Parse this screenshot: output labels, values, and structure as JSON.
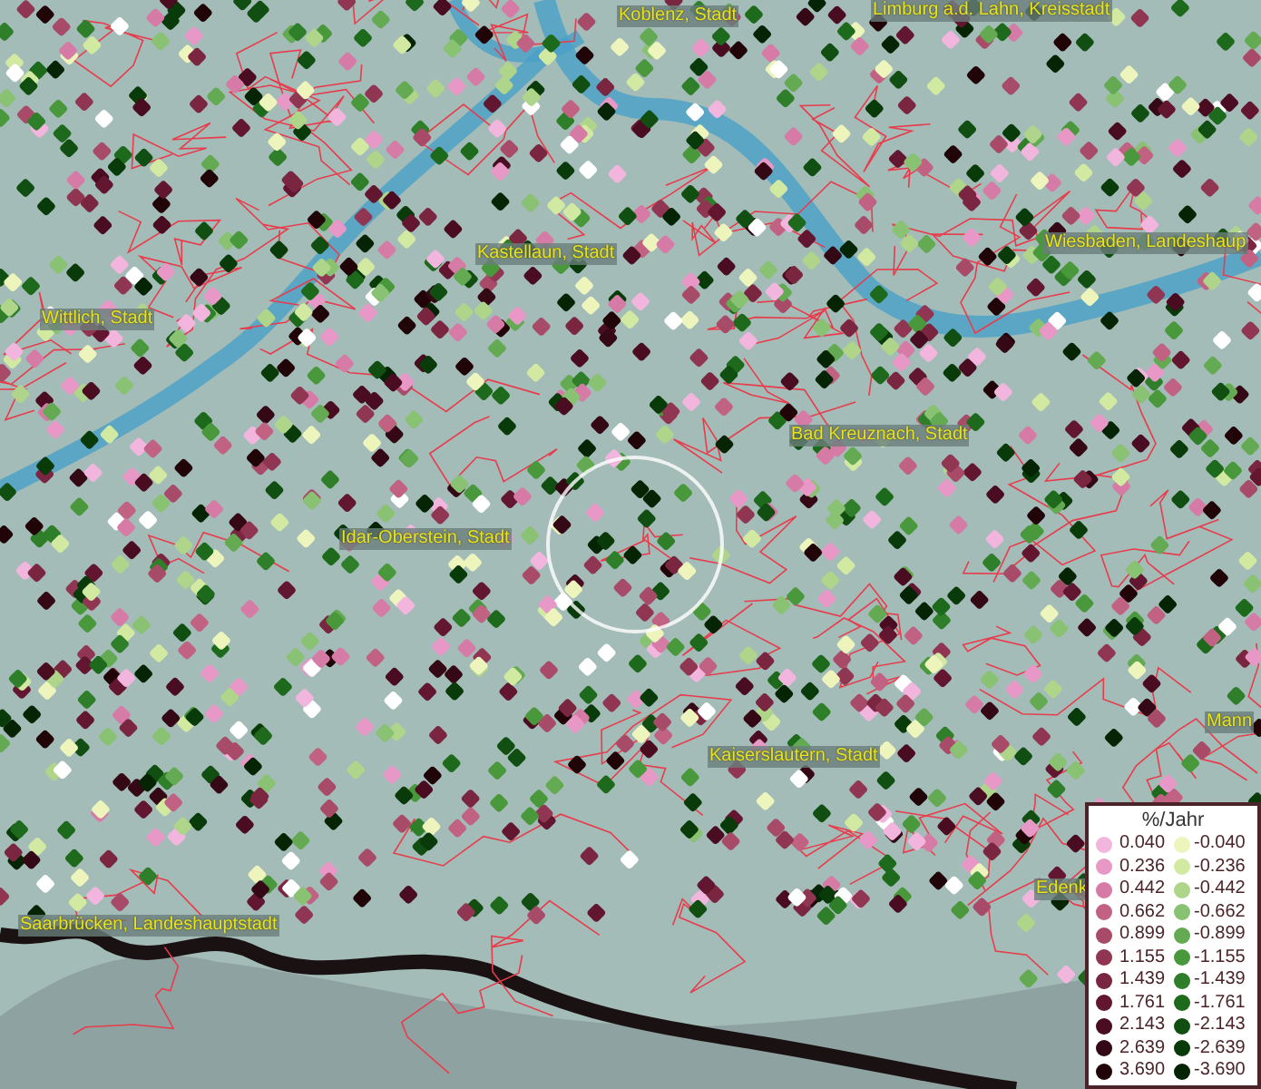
{
  "map": {
    "places": [
      {
        "name": "Koblenz, Stadt"
      },
      {
        "name": "Limburg a.d. Lahn, Kreisstadt"
      },
      {
        "name": "Kastellaun, Stadt"
      },
      {
        "name": "Wiesbaden, Landeshaup"
      },
      {
        "name": "Wittlich, Stadt"
      },
      {
        "name": "Bad Kreuznach, Stadt"
      },
      {
        "name": "Idar-Oberstein, Stadt"
      },
      {
        "name": "Mann"
      },
      {
        "name": "Kaiserslautern, Stadt"
      },
      {
        "name": "Edenk"
      },
      {
        "name": "Saarbrücken, Landeshauptstadt"
      }
    ]
  },
  "legend": {
    "title": "%/Jahr",
    "entries": [
      {
        "positive": {
          "label": "0.040",
          "color": "#f2b6de"
        },
        "negative": {
          "label": "-0.040",
          "color": "#edf5bc"
        }
      },
      {
        "positive": {
          "label": "0.236",
          "color": "#e898c6"
        },
        "negative": {
          "label": "-0.236",
          "color": "#d2e9a2"
        }
      },
      {
        "positive": {
          "label": "0.442",
          "color": "#d67aa6"
        },
        "negative": {
          "label": "-0.442",
          "color": "#aed58a"
        }
      },
      {
        "positive": {
          "label": "0.662",
          "color": "#c26282"
        },
        "negative": {
          "label": "-0.662",
          "color": "#88c272"
        }
      },
      {
        "positive": {
          "label": "0.899",
          "color": "#a84b68"
        },
        "negative": {
          "label": "-0.899",
          "color": "#64aa52"
        }
      },
      {
        "positive": {
          "label": "1.155",
          "color": "#903652"
        },
        "negative": {
          "label": "-1.155",
          "color": "#4a983c"
        }
      },
      {
        "positive": {
          "label": "1.439",
          "color": "#7a2640"
        },
        "negative": {
          "label": "-1.439",
          "color": "#2f7f2a"
        }
      },
      {
        "positive": {
          "label": "1.761",
          "color": "#621630"
        },
        "negative": {
          "label": "-1.761",
          "color": "#1e6a1c"
        }
      },
      {
        "positive": {
          "label": "2.143",
          "color": "#4a0c20"
        },
        "negative": {
          "label": "-2.143",
          "color": "#104f11"
        }
      },
      {
        "positive": {
          "label": "2.639",
          "color": "#340814"
        },
        "negative": {
          "label": "-2.639",
          "color": "#093a09"
        }
      },
      {
        "positive": {
          "label": "3.690",
          "color": "#200408"
        },
        "negative": {
          "label": "-3.690",
          "color": "#042404"
        }
      }
    ]
  }
}
